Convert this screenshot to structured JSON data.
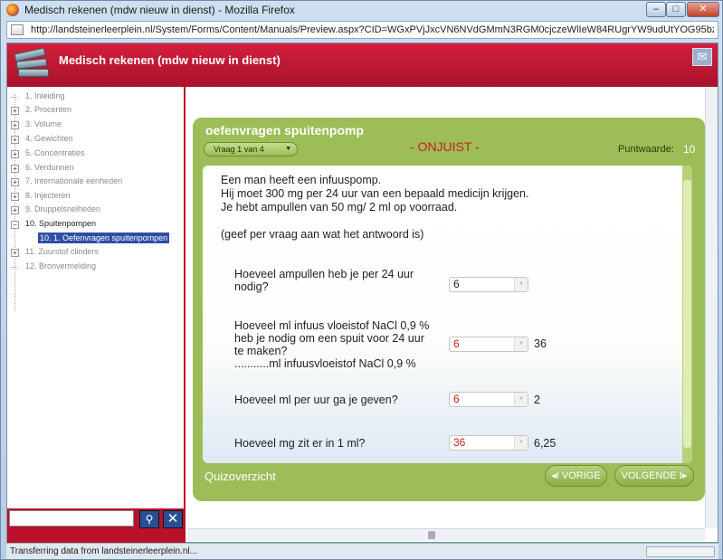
{
  "window": {
    "title": "Medisch rekenen (mdw nieuw in dienst) - Mozilla Firefox",
    "url": "http://landsteinerleerplein.nl/System/Forms/Content/Manuals/Preview.aspx?CID=WGxPVjJxcVN6NVdGMmN3RGM0cjczeWlIeW84RUgrYW9udUtYOG95bzV5dDNnd2FzZjhSTnBnP"
  },
  "app": {
    "title": "Medisch rekenen (mdw nieuw in dienst)"
  },
  "sidebar": {
    "items": [
      {
        "label": "1. Inleiding"
      },
      {
        "label": "2. Procenten"
      },
      {
        "label": "3. Volume"
      },
      {
        "label": "4. Gewichten"
      },
      {
        "label": "5. Concentraties"
      },
      {
        "label": "6. Verdunnen"
      },
      {
        "label": "7. Internationale eenheden"
      },
      {
        "label": "8. Injecteren"
      },
      {
        "label": "9. Druppelsnelheden"
      },
      {
        "label": "10. Spuitenpompen"
      },
      {
        "label": "11. Zuurstof clinders"
      },
      {
        "label": "12. Bronvermelding"
      }
    ],
    "selected_sub": "10. 1. Oefenvragen spuitenpompen"
  },
  "quiz": {
    "title": "oefenvragen spuitenpomp",
    "question_select": "Vraag 1 van 4",
    "status": "- ONJUIST -",
    "points_label": "Puntwaarde:",
    "points_value": "10",
    "intro": [
      "Een man heeft een infuuspomp.",
      "Hij moet 300 mg per 24 uur van een bepaald medicijn krijgen.",
      "Je hebt ampullen van 50 mg/ 2 ml op voorraad."
    ],
    "instruction": "(geef per vraag aan wat het antwoord is)",
    "questions": [
      {
        "label": [
          "Hoeveel ampullen heb je per 24 uur",
          "nodig?"
        ],
        "value": "6",
        "answer": ""
      },
      {
        "label": [
          "Hoeveel ml infuus vloeistof NaCl 0,9 %",
          "heb je nodig om een spuit voor 24 uur",
          "te maken?",
          "...........ml infuusvloeistof NaCl 0,9 %"
        ],
        "value": "6",
        "answer": "36"
      },
      {
        "label": [
          "Hoeveel ml per uur ga je geven?"
        ],
        "value": "6",
        "answer": "2"
      },
      {
        "label": [
          "Hoeveel mg zit er in 1 ml?"
        ],
        "value": "36",
        "answer": "6,25"
      }
    ],
    "overview_label": "Quizoverzicht",
    "prev_label": "◂I VORIGE",
    "next_label": "VOLGENDE I▸"
  },
  "statusbar": {
    "text": "Transferring data from landsteinerleerplein.nl..."
  }
}
